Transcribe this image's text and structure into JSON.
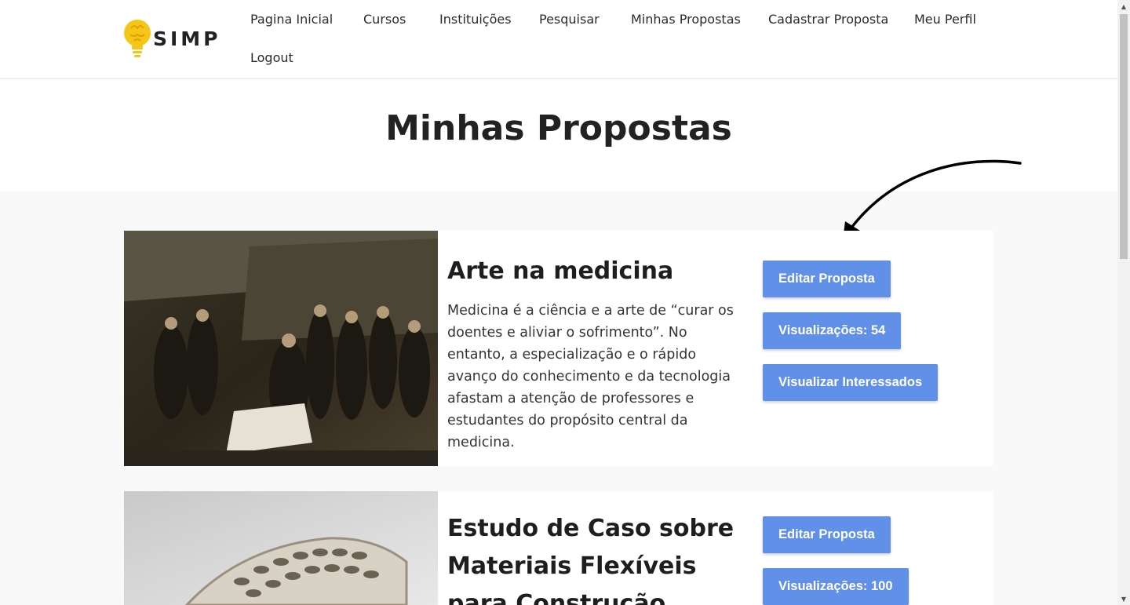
{
  "brand": {
    "logo_text": "SIMP",
    "accent": "#f5c518"
  },
  "nav": {
    "items": [
      "Pagina Inicial",
      "Cursos",
      "Instituições",
      "Pesquisar",
      "Minhas Propostas",
      "Cadastrar Proposta",
      "Meu Perfil",
      "Logout"
    ]
  },
  "page": {
    "title": "Minhas Propostas"
  },
  "proposals": [
    {
      "title": "Arte na medicina",
      "description": "Medicina é a ciência e a arte de “curar os doentes e aliviar o sofrimento”. No entanto, a especialização e o rápido avanço do conhecimento e da tecnologia afastam a atenção de professores e estudantes do propósito central da medicina.",
      "edit_label": "Editar Proposta",
      "views_label": "Visualizações: 54",
      "interested_label": "Visualizar Interessados"
    },
    {
      "title": "Estudo de Caso sobre Materiais Flexíveis para Construção",
      "edit_label": "Editar Proposta",
      "views_label": "Visualizações: 100"
    }
  ],
  "colors": {
    "button": "#6190e8",
    "page_bg": "#f9f9f9"
  }
}
